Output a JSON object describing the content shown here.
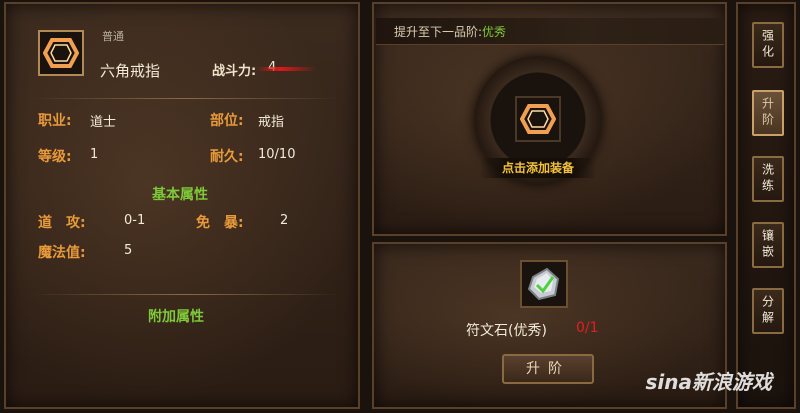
{
  "item": {
    "quality": "普通",
    "name": "六角戒指",
    "power_label": "战斗力:",
    "power_value": "4"
  },
  "attributes": [
    {
      "label": "职业:",
      "value": "道士"
    },
    {
      "label": "部位:",
      "value": "戒指"
    },
    {
      "label": "等级:",
      "value": "1"
    },
    {
      "label": "耐久:",
      "value": "10/10"
    }
  ],
  "basic_title": "基本属性",
  "basic_stats": [
    {
      "label": "道　攻:",
      "value": "0-1"
    },
    {
      "label": "免　暴:",
      "value": "2"
    },
    {
      "label": "魔法值:",
      "value": "5"
    }
  ],
  "extra_title": "附加属性",
  "upgrade": {
    "hint_prefix": "提升至下一品阶:",
    "hint_quality": "优秀",
    "add_label": "点击添加装备",
    "material_name": "符文石(优秀)",
    "material_count": "0/1",
    "button_label": "升阶"
  },
  "tabs": [
    "强化",
    "升阶",
    "洗练",
    "镶嵌",
    "分解"
  ],
  "active_tab": "升阶",
  "watermark": "sina新浪游戏",
  "colors": {
    "label_orange": "#e89a3a",
    "section_green": "#7ec93a",
    "count_red": "#e02020",
    "add_label_gold": "#f2c23a"
  }
}
